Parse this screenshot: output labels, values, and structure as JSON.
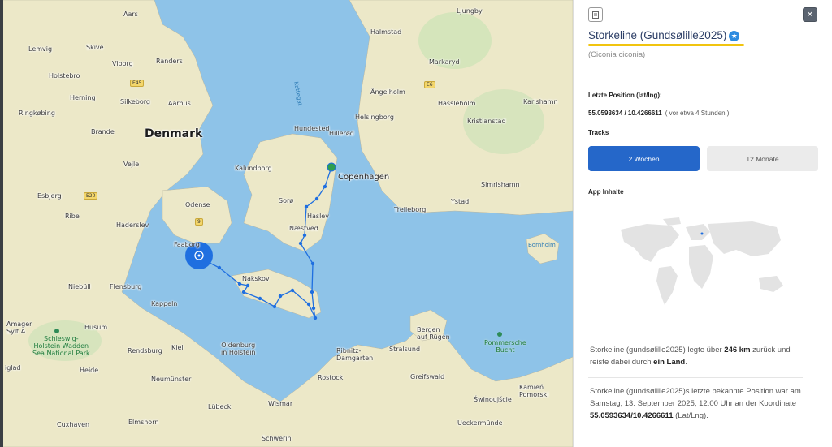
{
  "map": {
    "labels": {
      "country": "Denmark",
      "copenhagen": "Copenhagen",
      "aars": "Aars",
      "randers": "Randers",
      "viborg": "Viborg",
      "skive": "Skive",
      "lemvig": "Lemvig",
      "holstebro": "Holstebro",
      "herning": "Herning",
      "silkeborg": "Silkeborg",
      "aarhus": "Aarhus",
      "ringkobing": "Ringkøbing",
      "brande": "Brande",
      "vejle": "Vejle",
      "esbjerg": "Esbjerg",
      "ribe": "Ribe",
      "haderslev": "Haderslev",
      "odense": "Odense",
      "faaborg": "Faaborg",
      "niebull": "Niebüll",
      "flensburg": "Flensburg",
      "husum": "Husum",
      "kappeln": "Kappeln",
      "kiel": "Kiel",
      "rendsburg": "Rendsburg",
      "heide": "Heide",
      "neumunster": "Neumünster",
      "oldenburg": "Oldenburg\nin Holstein",
      "lubeck": "Lübeck",
      "wismar": "Wismar",
      "schwerin": "Schwerin",
      "elmshorn": "Elmshorn",
      "cuxhaven": "Cuxhaven",
      "rostock": "Rostock",
      "ribnitz": "Ribnitz-\nDamgarten",
      "stralsund": "Stralsund",
      "bergen": "Bergen\nauf Rügen",
      "greifswald": "Greifswald",
      "swinoujscie": "Świnoujście",
      "ueckermunde": "Ueckermünde",
      "kamien": "Kamień\nPomorski",
      "kalundborg": "Kalundborg",
      "soro": "Sorø",
      "haslev": "Haslev",
      "naestved": "Næstved",
      "nakskov": "Nakskov",
      "hundested": "Hundested",
      "hillerod": "Hillerød",
      "helsingborg": "Helsingborg",
      "angelholm": "Ängelholm",
      "halmstad": "Halmstad",
      "markaryd": "Markaryd",
      "hassleholm": "Hässleholm",
      "kristianstad": "Kristianstad",
      "karlshamn": "Karlshamn",
      "ljungby": "Ljungby",
      "ystad": "Ystad",
      "trelleborg": "Trelleborg",
      "simrishamn": "Simrishamn",
      "bornholm": "Bornholm",
      "kattegat": "Kattegat",
      "schleswig_park": "Schleswig-\nHolstein Wadden\nSea National Park",
      "pommersche": "Pommersche\nBucht",
      "sylt": "Amager\nSylt A",
      "iglad": "iglad"
    },
    "roads": {
      "e45": "E45",
      "e20": "E20",
      "e6": "E6",
      "r9": "9"
    },
    "route_color": "#1f6fe0",
    "current_marker_color": "#1f6fe0"
  },
  "panel": {
    "info_icon": "list-icon",
    "close_icon": "close-icon",
    "title": "Storkeline (Gundsølille2025)",
    "scientific_name": "(Ciconia ciconia)",
    "last_position_label": "Letzte Position (lat/lng):",
    "coords_value": "55.0593634 / 10.4266611",
    "coords_ago": "( vor etwa 4 Stunden )",
    "tracks_label": "Tracks",
    "tab_2w": "2 Wochen",
    "tab_12m": "12 Monate",
    "app_content_label": "App Inhalte",
    "para1_a": "Storkeline (gundsølille2025) legte über ",
    "para1_km": "246 km",
    "para1_b": " zurück und reiste dabei durch ",
    "para1_land": "ein Land",
    "para1_c": ".",
    "para2_a": "Storkeline (gundsølille2025)s letzte bekannte Position war am Samstag, 13. September 2025, 12.00 Uhr an der Koordinate ",
    "para2_coords": "55.0593634/10.4266611",
    "para2_b": " (Lat/Lng).",
    "accent_yellow": "#f1c40f",
    "tab_active_color": "#2567c9"
  }
}
